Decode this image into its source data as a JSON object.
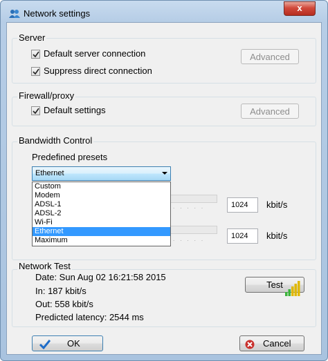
{
  "window": {
    "title": "Network settings",
    "close_label": "x"
  },
  "server": {
    "group_label": "Server",
    "default_connection": {
      "label": "Default server connection",
      "checked": true
    },
    "suppress_direct": {
      "label": "Suppress direct connection",
      "checked": true
    },
    "advanced_label": "Advanced"
  },
  "firewall": {
    "group_label": "Firewall/proxy",
    "default_settings": {
      "label": "Default settings",
      "checked": true
    },
    "advanced_label": "Advanced"
  },
  "bandwidth": {
    "group_label": "Bandwidth Control",
    "presets_label": "Predefined presets",
    "selected": "Ethernet",
    "options": [
      "Custom",
      "Modem",
      "ADSL-1",
      "ADSL-2",
      "Wi-Fi",
      "Ethernet",
      "Maximum"
    ],
    "upload": {
      "value": "1024",
      "unit": "kbit/s"
    },
    "download": {
      "value": "1024",
      "unit": "kbit/s"
    }
  },
  "network_test": {
    "group_label": "Network Test",
    "date": "Date: Sun Aug 02 16:21:58 2015",
    "in": "In: 187 kbit/s",
    "out": "Out: 558 kbit/s",
    "latency": "Predicted latency: 2544 ms",
    "test_label": "Test",
    "signal_level": 5,
    "signal_color": "#e0b800",
    "signal_color_low": "#3cb43c"
  },
  "footer": {
    "ok_label": "OK",
    "cancel_label": "Cancel"
  },
  "icons": {
    "app": "network-users-icon",
    "ok": "checkmark-icon",
    "cancel": "cancel-icon"
  },
  "colors": {
    "selection": "#3399ff",
    "title_bar": "#b6cde6",
    "close_button": "#c94032"
  }
}
